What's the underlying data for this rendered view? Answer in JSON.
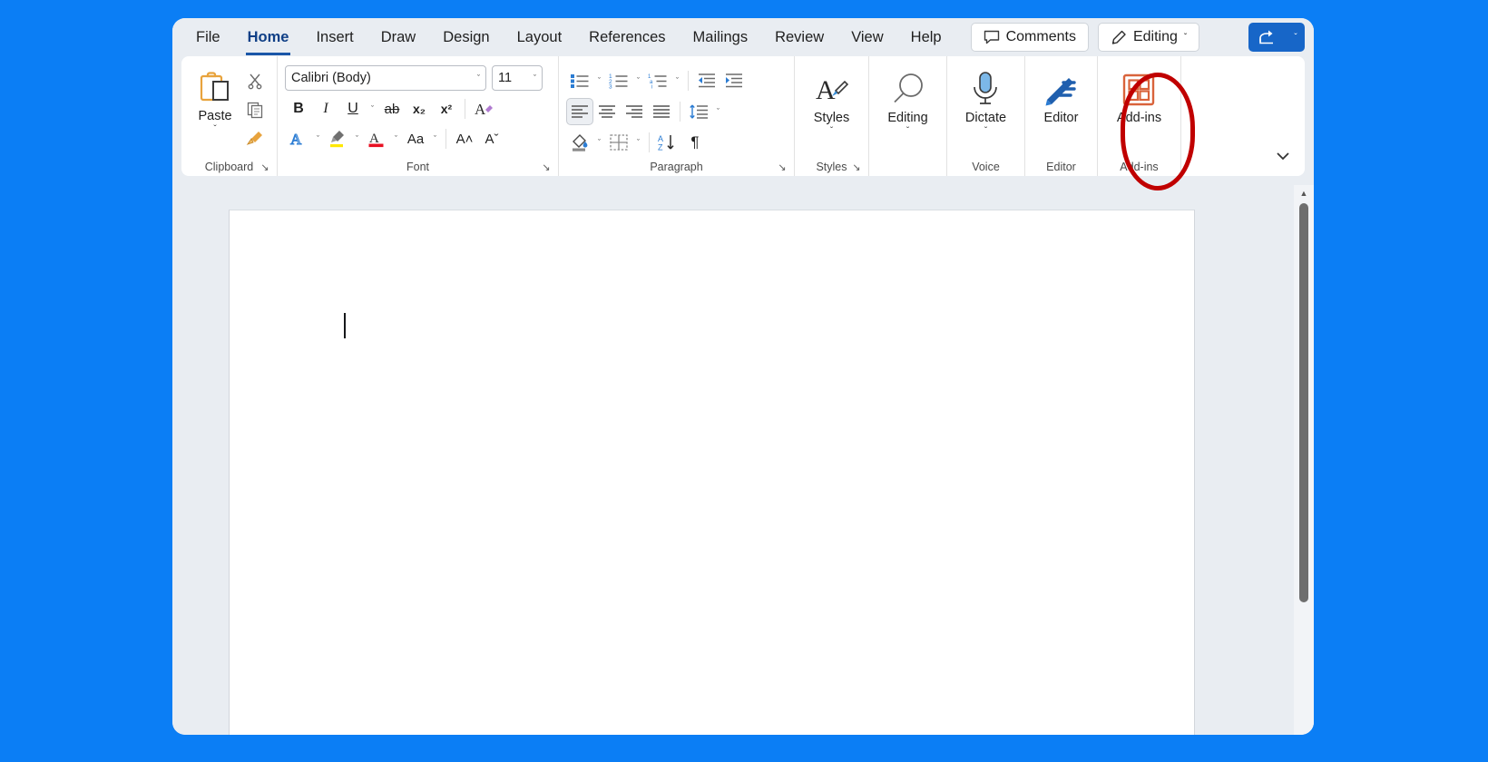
{
  "window": {
    "app": "Microsoft Word"
  },
  "tabs": [
    {
      "label": "File",
      "active": false
    },
    {
      "label": "Home",
      "active": true
    },
    {
      "label": "Insert",
      "active": false
    },
    {
      "label": "Draw",
      "active": false
    },
    {
      "label": "Design",
      "active": false
    },
    {
      "label": "Layout",
      "active": false
    },
    {
      "label": "References",
      "active": false
    },
    {
      "label": "Mailings",
      "active": false
    },
    {
      "label": "Review",
      "active": false
    },
    {
      "label": "View",
      "active": false
    },
    {
      "label": "Help",
      "active": false
    }
  ],
  "titlebar": {
    "comments_label": "Comments",
    "comments_icon": "comment-bubble-icon",
    "editing_label": "Editing",
    "editing_icon": "pencil-icon",
    "editing_caret": "ˇ",
    "share_icon": "share-icon",
    "share_caret": "ˇ"
  },
  "ribbon": {
    "collapse_icon": "chevron-down-icon",
    "groups": [
      {
        "name": "clipboard",
        "label": "Clipboard",
        "launcher": "↘",
        "paste": {
          "label": "Paste",
          "icon": "clipboard-icon",
          "caret": "ˇ"
        },
        "items": [
          {
            "name": "cut",
            "icon": "scissors-icon"
          },
          {
            "name": "copy",
            "icon": "copy-icon"
          },
          {
            "name": "format-painter",
            "icon": "paintbrush-icon"
          }
        ]
      },
      {
        "name": "font",
        "label": "Font",
        "launcher": "↘",
        "font_name": {
          "value": "Calibri (Body)",
          "caret": "ˇ"
        },
        "font_size": {
          "value": "11",
          "caret": "ˇ"
        },
        "row1": [
          {
            "name": "bold",
            "glyph": "B"
          },
          {
            "name": "italic",
            "glyph": "I"
          },
          {
            "name": "underline",
            "glyph": "U"
          },
          {
            "name": "underline-caret",
            "glyph": "ˇ"
          },
          {
            "name": "strikethrough",
            "glyph": "ab"
          },
          {
            "name": "subscript",
            "glyph": "x₂"
          },
          {
            "name": "superscript",
            "glyph": "x²"
          },
          {
            "name": "clear-formatting",
            "glyph": "A"
          }
        ],
        "row2": [
          {
            "name": "text-effects",
            "glyph": "A",
            "caret": "ˇ"
          },
          {
            "name": "text-highlight",
            "glyph": "",
            "caret": "ˇ"
          },
          {
            "name": "font-color",
            "glyph": "A",
            "caret": "ˇ"
          },
          {
            "name": "change-case",
            "glyph": "Aa",
            "caret": "ˇ"
          },
          {
            "name": "grow-font",
            "glyph": "A˄",
            "caret": ""
          },
          {
            "name": "shrink-font",
            "glyph": "Aˇ",
            "caret": ""
          }
        ]
      },
      {
        "name": "paragraph",
        "label": "Paragraph",
        "launcher": "↘",
        "row1": [
          {
            "name": "bullets",
            "caret": "ˇ"
          },
          {
            "name": "numbering",
            "caret": "ˇ"
          },
          {
            "name": "multilevel-list",
            "caret": "ˇ"
          },
          {
            "name": "decrease-indent",
            "caret": ""
          },
          {
            "name": "increase-indent",
            "caret": ""
          }
        ],
        "row2": [
          {
            "name": "align-left",
            "selected": true
          },
          {
            "name": "align-center",
            "selected": false
          },
          {
            "name": "align-right",
            "selected": false
          },
          {
            "name": "justify",
            "selected": false
          },
          {
            "name": "line-spacing",
            "caret": "ˇ"
          },
          {
            "name": "shading",
            "caret": "ˇ"
          },
          {
            "name": "borders",
            "caret": "ˇ"
          },
          {
            "name": "sort",
            "caret": ""
          },
          {
            "name": "show-formatting",
            "glyph": "¶"
          }
        ]
      },
      {
        "name": "styles",
        "label": "Styles",
        "launcher": "↘",
        "button": {
          "label": "Styles",
          "icon": "styles-icon",
          "caret": "ˇ"
        }
      },
      {
        "name": "editing",
        "label": "",
        "button": {
          "label": "Editing",
          "icon": "magnifier-icon",
          "caret": "ˇ"
        }
      },
      {
        "name": "voice",
        "label": "Voice",
        "button": {
          "label": "Dictate",
          "icon": "microphone-icon",
          "caret": "ˇ"
        },
        "annotated": true
      },
      {
        "name": "editor-group",
        "label": "Editor",
        "button": {
          "label": "Editor",
          "icon": "editor-pen-icon",
          "caret": ""
        }
      },
      {
        "name": "addins",
        "label": "Add-ins",
        "button": {
          "label": "Add-ins",
          "icon": "addins-grid-icon",
          "caret": ""
        }
      }
    ]
  },
  "document": {
    "content": "",
    "caret_visible": true
  },
  "scrollbar": {
    "up_arrow": "▲"
  },
  "colors": {
    "desktop_background": "#0b7ef5",
    "annotation": "#c00000",
    "accent_blue": "#1766c8",
    "ribbon_bg": "#ffffff",
    "chrome_bg": "#e9edf2"
  }
}
